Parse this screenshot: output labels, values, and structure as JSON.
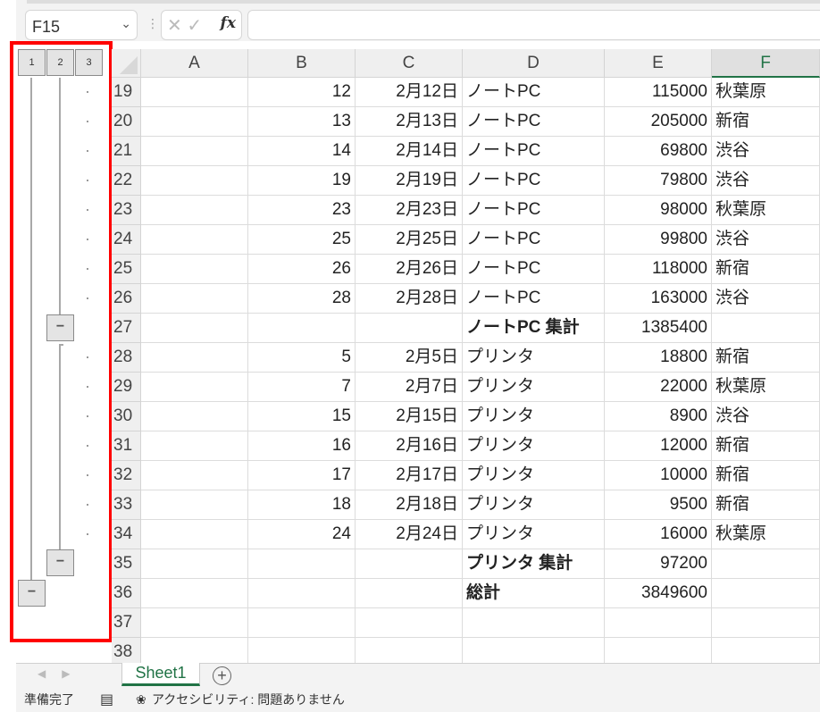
{
  "namebox": "F15",
  "fx_label": "fx",
  "outline_levels": [
    "1",
    "2",
    "3"
  ],
  "columns": [
    "A",
    "B",
    "C",
    "D",
    "E",
    "F"
  ],
  "selected_column": "F",
  "rows": [
    {
      "n": "19",
      "B": "12",
      "C": "2月12日",
      "D": "ノートPC",
      "E": "115000",
      "F": "秋葉原"
    },
    {
      "n": "20",
      "B": "13",
      "C": "2月13日",
      "D": "ノートPC",
      "E": "205000",
      "F": "新宿"
    },
    {
      "n": "21",
      "B": "14",
      "C": "2月14日",
      "D": "ノートPC",
      "E": "69800",
      "F": "渋谷"
    },
    {
      "n": "22",
      "B": "19",
      "C": "2月19日",
      "D": "ノートPC",
      "E": "79800",
      "F": "渋谷"
    },
    {
      "n": "23",
      "B": "23",
      "C": "2月23日",
      "D": "ノートPC",
      "E": "98000",
      "F": "秋葉原"
    },
    {
      "n": "24",
      "B": "25",
      "C": "2月25日",
      "D": "ノートPC",
      "E": "99800",
      "F": "渋谷"
    },
    {
      "n": "25",
      "B": "26",
      "C": "2月26日",
      "D": "ノートPC",
      "E": "118000",
      "F": "新宿"
    },
    {
      "n": "26",
      "B": "28",
      "C": "2月28日",
      "D": "ノートPC",
      "E": "163000",
      "F": "渋谷"
    },
    {
      "n": "27",
      "B": "",
      "C": "",
      "D": "ノートPC 集計",
      "E": "1385400",
      "F": "",
      "bold": true
    },
    {
      "n": "28",
      "B": "5",
      "C": "2月5日",
      "D": "プリンタ",
      "E": "18800",
      "F": "新宿"
    },
    {
      "n": "29",
      "B": "7",
      "C": "2月7日",
      "D": "プリンタ",
      "E": "22000",
      "F": "秋葉原"
    },
    {
      "n": "30",
      "B": "15",
      "C": "2月15日",
      "D": "プリンタ",
      "E": "8900",
      "F": "渋谷"
    },
    {
      "n": "31",
      "B": "16",
      "C": "2月16日",
      "D": "プリンタ",
      "E": "12000",
      "F": "新宿"
    },
    {
      "n": "32",
      "B": "17",
      "C": "2月17日",
      "D": "プリンタ",
      "E": "10000",
      "F": "新宿"
    },
    {
      "n": "33",
      "B": "18",
      "C": "2月18日",
      "D": "プリンタ",
      "E": "9500",
      "F": "新宿"
    },
    {
      "n": "34",
      "B": "24",
      "C": "2月24日",
      "D": "プリンタ",
      "E": "16000",
      "F": "秋葉原"
    },
    {
      "n": "35",
      "B": "",
      "C": "",
      "D": "プリンタ 集計",
      "E": "97200",
      "F": "",
      "bold": true
    },
    {
      "n": "36",
      "B": "",
      "C": "",
      "D": "総計",
      "E": "3849600",
      "F": "",
      "bold": true
    },
    {
      "n": "37",
      "B": "",
      "C": "",
      "D": "",
      "E": "",
      "F": ""
    },
    {
      "n": "38",
      "B": "",
      "C": "",
      "D": "",
      "E": "",
      "F": ""
    }
  ],
  "sheet_tab": "Sheet1",
  "collapse_symbol": "−",
  "status": {
    "ready": "準備完了",
    "accessibility": "アクセシビリティ: 問題ありません"
  }
}
